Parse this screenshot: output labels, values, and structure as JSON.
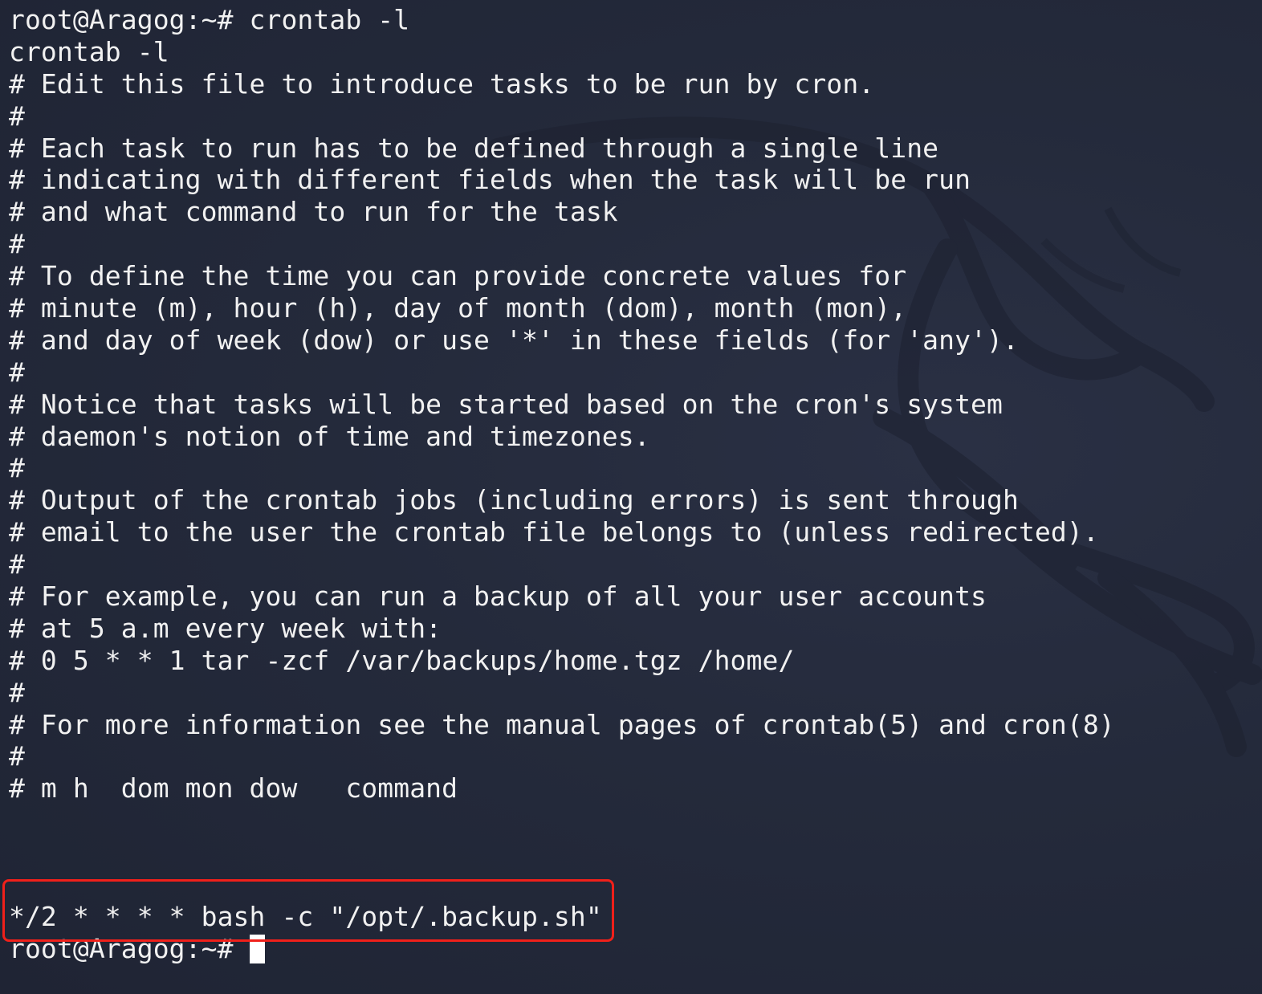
{
  "terminal": {
    "lines": [
      "root@Aragog:~# crontab -l",
      "crontab -l",
      "# Edit this file to introduce tasks to be run by cron.",
      "#",
      "# Each task to run has to be defined through a single line",
      "# indicating with different fields when the task will be run",
      "# and what command to run for the task",
      "#",
      "# To define the time you can provide concrete values for",
      "# minute (m), hour (h), day of month (dom), month (mon),",
      "# and day of week (dow) or use '*' in these fields (for 'any').",
      "#",
      "# Notice that tasks will be started based on the cron's system",
      "# daemon's notion of time and timezones.",
      "#",
      "# Output of the crontab jobs (including errors) is sent through",
      "# email to the user the crontab file belongs to (unless redirected).",
      "#",
      "# For example, you can run a backup of all your user accounts",
      "# at 5 a.m every week with:",
      "# 0 5 * * 1 tar -zcf /var/backups/home.tgz /home/",
      "#",
      "# For more information see the manual pages of crontab(5) and cron(8)",
      "#",
      "# m h  dom mon dow   command",
      "",
      "",
      "",
      "*/2 * * * * bash -c \"/opt/.backup.sh\""
    ],
    "prompt": "root@Aragog:~# "
  },
  "colors": {
    "background": "#23283a",
    "text": "#f1f1f1",
    "highlight_border": "#f0201a",
    "cursor": "#ffffff"
  }
}
